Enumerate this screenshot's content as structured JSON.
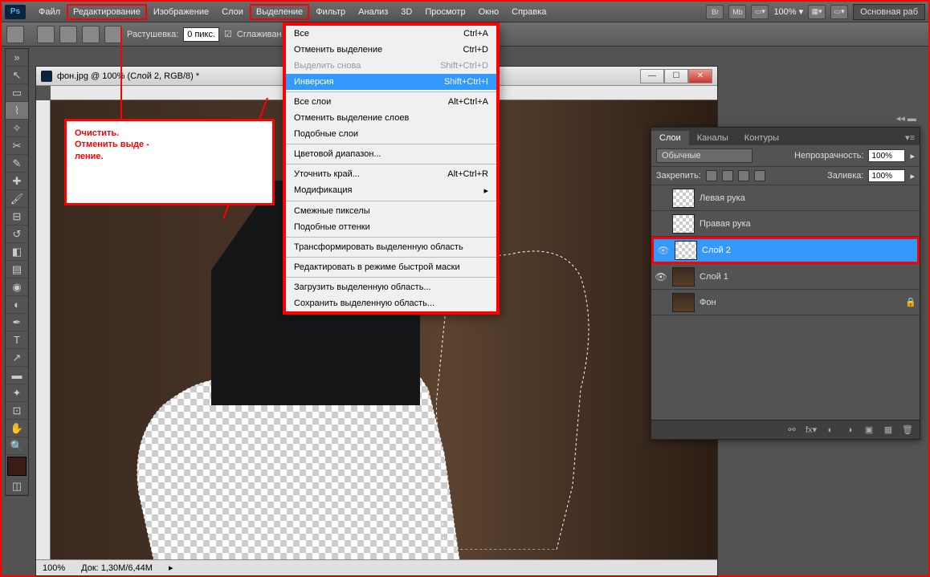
{
  "menubar": {
    "items": [
      "Файл",
      "Редактирование",
      "Изображение",
      "Слои",
      "Выделение",
      "Фильтр",
      "Анализ",
      "3D",
      "Просмотр",
      "Окно",
      "Справка"
    ],
    "zoom": "100% ▾",
    "workspace": "Основная раб"
  },
  "optionsbar": {
    "feather_label": "Растушевка:",
    "feather_value": "0 пикс.",
    "antialias": "Сглаживан"
  },
  "doc": {
    "title": "фон.jpg @ 100% (Слой 2, RGB/8) *",
    "status_zoom": "100%",
    "status_doc": "Док: 1,30M/6,44M"
  },
  "dropdown": {
    "items": [
      {
        "label": "Все",
        "sc": "Ctrl+A"
      },
      {
        "label": "Отменить выделение",
        "sc": "Ctrl+D"
      },
      {
        "label": "Выделить снова",
        "sc": "Shift+Ctrl+D",
        "dis": true
      },
      {
        "label": "Инверсия",
        "sc": "Shift+Ctrl+I",
        "sel": true
      },
      {
        "sep": true
      },
      {
        "label": "Все слои",
        "sc": "Alt+Ctrl+A"
      },
      {
        "label": "Отменить выделение слоев",
        "sc": ""
      },
      {
        "label": "Подобные слои",
        "sc": ""
      },
      {
        "sep": true
      },
      {
        "label": "Цветовой диапазон...",
        "sc": ""
      },
      {
        "sep": true
      },
      {
        "label": "Уточнить край...",
        "sc": "Alt+Ctrl+R"
      },
      {
        "label": "Модификация",
        "sc": "▸"
      },
      {
        "sep": true
      },
      {
        "label": "Смежные пикселы",
        "sc": ""
      },
      {
        "label": "Подобные оттенки",
        "sc": ""
      },
      {
        "sep": true
      },
      {
        "label": "Трансформировать выделенную область",
        "sc": ""
      },
      {
        "sep": true
      },
      {
        "label": "Редактировать в режиме быстрой маски",
        "sc": ""
      },
      {
        "sep": true
      },
      {
        "label": "Загрузить выделенную область...",
        "sc": ""
      },
      {
        "label": "Сохранить выделенную область...",
        "sc": ""
      }
    ]
  },
  "annot": {
    "l1": "Очистить.",
    "l2": "Отменить выде -",
    "l3": "ление."
  },
  "layers_panel": {
    "tabs": [
      "Слои",
      "Каналы",
      "Контуры"
    ],
    "blend": "Обычные",
    "opacity_label": "Непрозрачность:",
    "opacity": "100%",
    "lock_label": "Закрепить:",
    "fill_label": "Заливка:",
    "fill": "100%",
    "layers": [
      {
        "name": "Левая рука",
        "vis": false,
        "ck": true
      },
      {
        "name": "Правая рука",
        "vis": false,
        "ck": true
      },
      {
        "name": "Слой 2",
        "vis": true,
        "ck": true,
        "sel": true
      },
      {
        "name": "Слой 1",
        "vis": true,
        "ph": true
      },
      {
        "name": "Фон",
        "vis": false,
        "ph": true,
        "lock": true
      }
    ]
  }
}
